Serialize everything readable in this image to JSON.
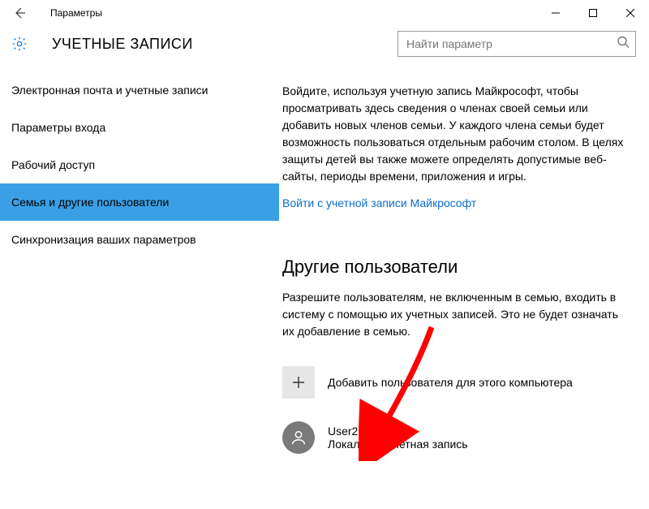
{
  "window": {
    "title": "Параметры"
  },
  "header": {
    "title": "УЧЕТНЫЕ ЗАПИСИ",
    "search_placeholder": "Найти параметр"
  },
  "sidebar": {
    "items": [
      {
        "label": "Электронная почта и учетные записи",
        "selected": false
      },
      {
        "label": "Параметры входа",
        "selected": false
      },
      {
        "label": "Рабочий доступ",
        "selected": false
      },
      {
        "label": "Семья и другие пользователи",
        "selected": true
      },
      {
        "label": "Синхронизация ваших параметров",
        "selected": false
      }
    ]
  },
  "main": {
    "family_intro": "Войдите, используя учетную запись Майкрософт, чтобы просматривать здесь сведения о членах своей семьи или добавить новых членов семьи. У каждого члена семьи будет возможность пользоваться отдельным рабочим столом. В целях защиты детей вы также можете определять допустимые веб-сайты, периоды времени, приложения и игры.",
    "ms_signin_link": "Войти с учетной записи Майкрософт",
    "other_users_heading": "Другие пользователи",
    "other_users_sub": "Разрешите пользователям, не включенным в семью, входить в систему с помощью их учетных записей. Это не будет означать их добавление в семью.",
    "add_user_label": "Добавить пользователя для этого компьютера",
    "user": {
      "name": "User2",
      "type": "Локальная учетная запись"
    }
  }
}
